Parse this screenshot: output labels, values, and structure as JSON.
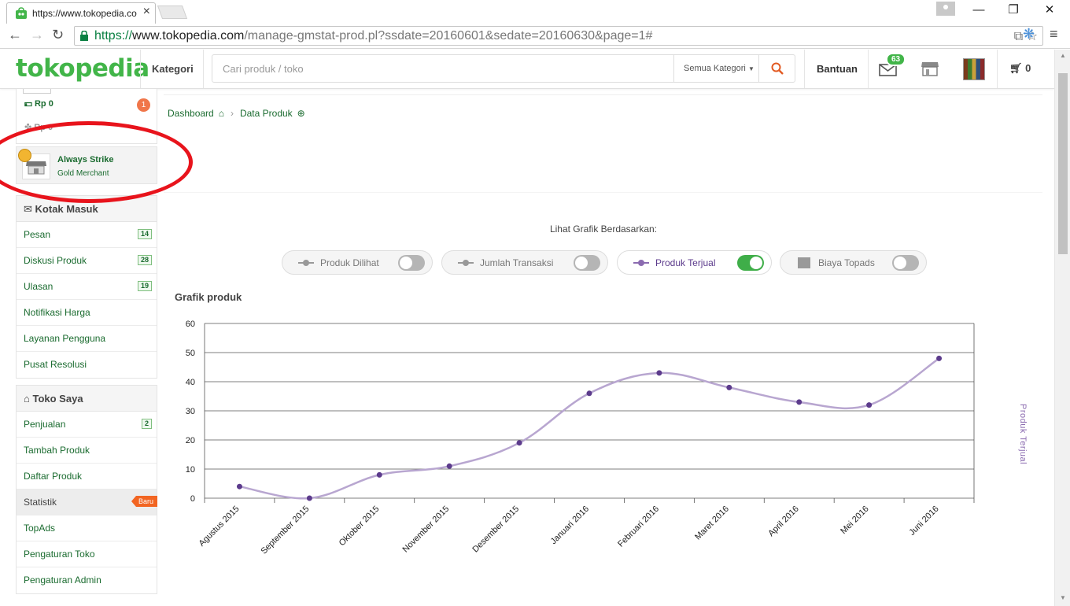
{
  "browser": {
    "tab_title": "https://www.tokopedia.co",
    "url_scheme": "https://",
    "url_host": "www.tokopedia.com",
    "url_path": "/manage-gmstat-prod.pl?ssdate=20160601&sedate=20160630&page=1#"
  },
  "header": {
    "logo": "tokopedia",
    "kategori": "Kategori",
    "search_placeholder": "Cari produk / toko",
    "search_category": "Semua Kategori",
    "bantuan": "Bantuan",
    "inbox_count": "63",
    "cart_count": "0",
    "brand_color": "#42b549"
  },
  "sidebar": {
    "balance": "Rp 0",
    "balance_badge": "1",
    "balance2": "Rp 0",
    "shop_name": "Always Strike",
    "shop_type": "Gold Merchant",
    "inbox": {
      "title": "Kotak Masuk",
      "items": [
        {
          "label": "Pesan",
          "count": "14"
        },
        {
          "label": "Diskusi Produk",
          "count": "28"
        },
        {
          "label": "Ulasan",
          "count": "19"
        },
        {
          "label": "Notifikasi Harga"
        },
        {
          "label": "Layanan Pengguna"
        },
        {
          "label": "Pusat Resolusi"
        }
      ]
    },
    "shop": {
      "title": "Toko Saya",
      "items": [
        {
          "label": "Penjualan",
          "count": "2"
        },
        {
          "label": "Tambah Produk"
        },
        {
          "label": "Daftar Produk"
        },
        {
          "label": "Statistik",
          "badge": "Baru"
        },
        {
          "label": "TopAds"
        },
        {
          "label": "Pengaturan Toko"
        },
        {
          "label": "Pengaturan Admin"
        }
      ]
    }
  },
  "main": {
    "breadcrumb": [
      "Dashboard",
      "Data Produk"
    ],
    "filter_label": "Lihat Grafik Berdasarkan:",
    "toggles": [
      {
        "label": "Produk Dilihat",
        "on": false
      },
      {
        "label": "Jumlah Transaksi",
        "on": false
      },
      {
        "label": "Produk Terjual",
        "on": true
      },
      {
        "label": "Biaya Topads",
        "on": false
      }
    ],
    "chart_heading": "Grafik produk"
  },
  "chart_data": {
    "type": "line",
    "categories": [
      "Agustus 2015",
      "September 2015",
      "Oktober 2015",
      "November 2015",
      "Desember 2015",
      "Januari 2016",
      "Februari 2016",
      "Maret 2016",
      "April 2016",
      "Mei 2016",
      "Juni 2016"
    ],
    "series": [
      {
        "name": "Produk Terjual",
        "values": [
          4,
          0,
          8,
          11,
          19,
          36,
          43,
          38,
          33,
          32,
          48
        ],
        "color": "#5c3b8c",
        "line_color": "#b8a6d0"
      }
    ],
    "yticks": [
      0,
      10,
      20,
      30,
      40,
      50,
      60
    ],
    "ylim": [
      0,
      60
    ],
    "ylabel_right": "Produk Terjual",
    "grid": true,
    "smooth": true
  }
}
